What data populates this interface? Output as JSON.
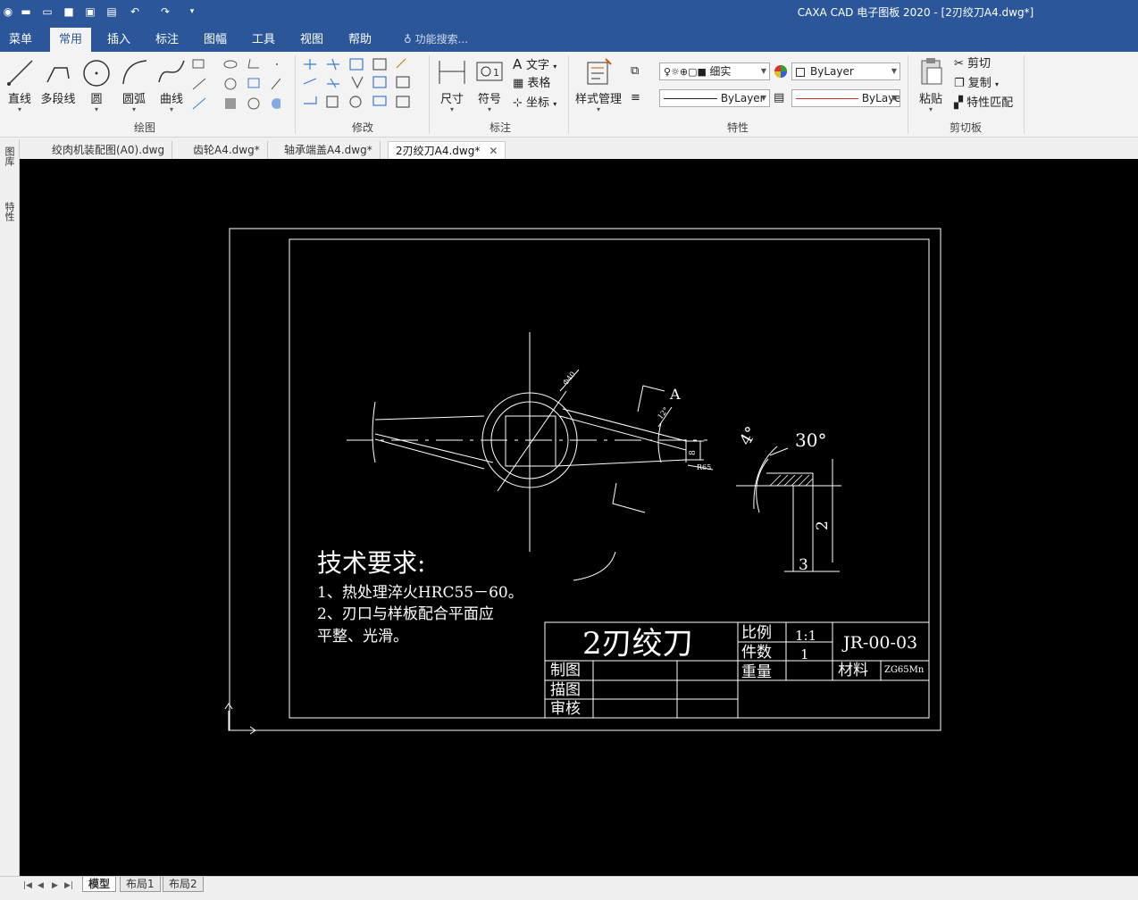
{
  "window": {
    "title": "CAXA CAD 电子图板 2020 - [2刃绞刀A4.dwg*]"
  },
  "menu": {
    "tabs": [
      "菜单",
      "常用",
      "插入",
      "标注",
      "图幅",
      "工具",
      "视图",
      "帮助"
    ],
    "active": "常用",
    "search_placeholder": "功能搜索..."
  },
  "ribbon": {
    "draw": {
      "label": "绘图",
      "line": "直线",
      "polyline": "多段线",
      "circle": "圆",
      "arc": "圆弧",
      "curve": "曲线"
    },
    "modify": {
      "label": "修改"
    },
    "annotate": {
      "label": "标注",
      "dimension": "尺寸",
      "symbol": "符号",
      "text": "文字",
      "table": "表格",
      "coordinate": "坐标"
    },
    "style": {
      "label": "样式管理"
    },
    "properties": {
      "label": "特性",
      "layer": "细实",
      "color": "ByLayer",
      "linetype": "ByLayer",
      "lineweight": "ByLayе"
    },
    "clipboard": {
      "label": "剪切板",
      "paste": "粘贴",
      "cut": "剪切",
      "copy": "复制",
      "match": "特性匹配"
    }
  },
  "doc_tabs": [
    "绞肉机装配图(A0).dwg",
    "齿轮A4.dwg*",
    "轴承端盖A4.dwg*",
    "2刃绞刀A4.dwg*"
  ],
  "side_tabs": [
    "图库",
    "特性"
  ],
  "layout_tabs": [
    "模型",
    "布局1",
    "布局2"
  ],
  "drawing": {
    "tech_title": "技术要求:",
    "tech_line1": "1、热处理淬火HRC55－60。",
    "tech_line2": "2、刃口与样板配合平面应",
    "tech_line3": "平整、光滑。",
    "part_name": "2刃绞刀",
    "scale_label": "比例",
    "scale_value": "1:1",
    "qty_label": "件数",
    "qty_value": "1",
    "weight_label": "重量",
    "drawing_no": "JR-00-03",
    "material_label": "材料",
    "material_value": "ZG65Mn",
    "made_by": "制图",
    "traced_by": "描图",
    "checked_by": "审核",
    "dim_d": "Φ40",
    "dim_angle_small": "12°",
    "dim_8": "8",
    "dim_r": "R65",
    "view_A": "A",
    "dim_4deg": "4°",
    "dim_30deg": "30°",
    "dim_2": "2",
    "dim_3": "3"
  }
}
